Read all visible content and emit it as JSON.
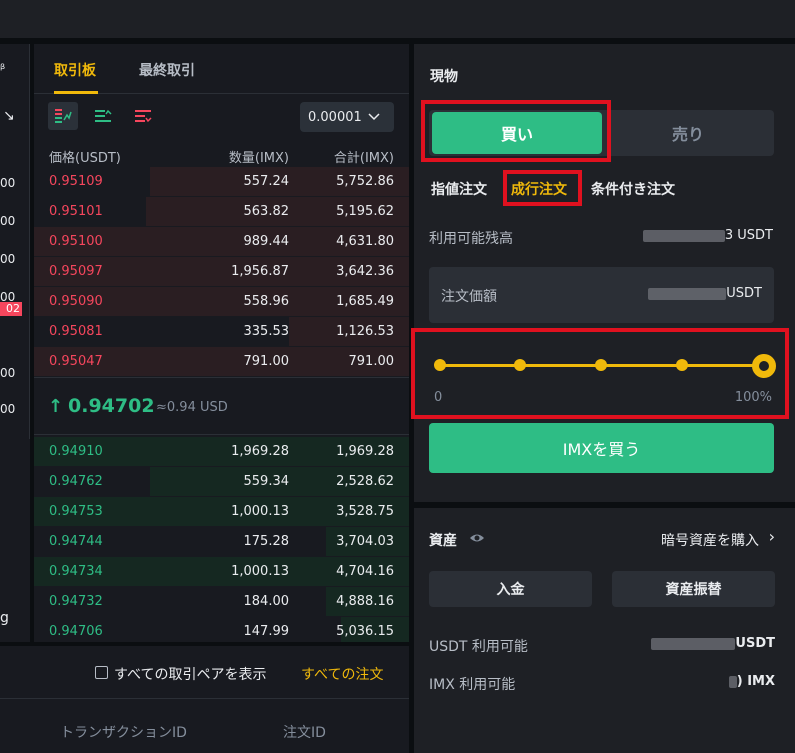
{
  "left_column": {
    "icon": "expand-icon",
    "values": [
      "00",
      "00",
      "00",
      "00",
      "00",
      "00",
      "00",
      "00",
      "00"
    ],
    "highlight": "02",
    "tail": "g"
  },
  "order_book": {
    "tabs": [
      {
        "label": "取引板",
        "active": true
      },
      {
        "label": "最終取引",
        "active": false
      }
    ],
    "precision": "0.00001",
    "headers": {
      "price": "価格(USDT)",
      "qty": "数量(IMX)",
      "total": "合計(IMX)"
    },
    "asks": [
      {
        "price": "0.95109",
        "qty": "557.24",
        "total": "5,752.86",
        "depth": 0.69
      },
      {
        "price": "0.95101",
        "qty": "563.82",
        "total": "5,195.62",
        "depth": 0.7
      },
      {
        "price": "0.95100",
        "qty": "989.44",
        "total": "4,631.80",
        "depth": 1.0
      },
      {
        "price": "0.95097",
        "qty": "1,956.87",
        "total": "3,642.36",
        "depth": 1.0
      },
      {
        "price": "0.95090",
        "qty": "558.96",
        "total": "1,685.49",
        "depth": 1.0
      },
      {
        "price": "0.95081",
        "qty": "335.53",
        "total": "1,126.53",
        "depth": 0.32
      },
      {
        "price": "0.95047",
        "qty": "791.00",
        "total": "791.00",
        "depth": 1.0
      }
    ],
    "last_price": "0.94702",
    "last_price_usd": "≈0.94 USD",
    "bids": [
      {
        "price": "0.94910",
        "qty": "1,969.28",
        "total": "1,969.28",
        "depth": 1.0
      },
      {
        "price": "0.94762",
        "qty": "559.34",
        "total": "2,528.62",
        "depth": 0.69
      },
      {
        "price": "0.94753",
        "qty": "1,000.13",
        "total": "3,528.75",
        "depth": 1.0
      },
      {
        "price": "0.94744",
        "qty": "175.28",
        "total": "3,704.03",
        "depth": 0.22
      },
      {
        "price": "0.94734",
        "qty": "1,000.13",
        "total": "4,704.16",
        "depth": 1.0
      },
      {
        "price": "0.94732",
        "qty": "184.00",
        "total": "4,888.16",
        "depth": 0.22
      },
      {
        "price": "0.94706",
        "qty": "147.99",
        "total": "5,036.15",
        "depth": 0.18
      }
    ]
  },
  "orders": {
    "show_all_pairs": "すべての取引ペアを表示",
    "all_orders": "すべての注文",
    "col_tx": "トランザクションID",
    "col_order": "注文ID"
  },
  "trade": {
    "title": "現物",
    "buy": "買い",
    "sell": "売り",
    "order_types": [
      "指値注文",
      "成行注文",
      "条件付き注文"
    ],
    "available_label": "利用可能残高",
    "available_suffix": "3 USDT",
    "price_label": "注文価額",
    "price_suffix": "USDT",
    "slider_level": 1.0,
    "slider_min": "0",
    "slider_max": "100%",
    "buy_button": "IMXを買う"
  },
  "assets": {
    "title": "資産",
    "buy_crypto": "暗号資産を購入",
    "deposit": "入金",
    "transfer": "資産振替",
    "usdt_label": "USDT 利用可能",
    "usdt_suffix": "USDT",
    "imx_label": "IMX 利用可能",
    "imx_suffix": ") IMX"
  },
  "colors": {
    "buy_green": "#2ebd85",
    "sell_red": "#f6465d",
    "accent_yellow": "#f0b90b",
    "highlight_box": "#e0111f"
  }
}
